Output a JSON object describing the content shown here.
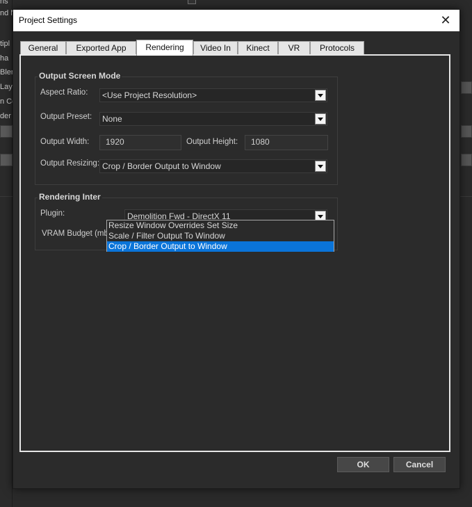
{
  "background": {
    "left_labels": [
      "ns",
      "nd N",
      "tipl",
      "ha",
      "Blen",
      "Lay",
      "n Co",
      "der T"
    ]
  },
  "dialog": {
    "title": "Project Settings",
    "close_symbol": "✕"
  },
  "tabs": [
    {
      "label": "General"
    },
    {
      "label": "Exported App"
    },
    {
      "label": "Rendering",
      "active": true
    },
    {
      "label": "Video In"
    },
    {
      "label": "Kinect"
    },
    {
      "label": "VR"
    },
    {
      "label": "Protocols"
    }
  ],
  "output_screen_mode": {
    "title": "Output Screen Mode",
    "aspect_ratio_label": "Aspect Ratio:",
    "aspect_ratio_value": "<Use Project Resolution>",
    "output_preset_label": "Output Preset:",
    "output_preset_value": "None",
    "output_width_label": "Output Width:",
    "output_width_value": "1920",
    "output_height_label": "Output Height:",
    "output_height_value": "1080",
    "output_resizing_label": "Output Resizing:",
    "output_resizing_value": "Crop / Border Output to Window"
  },
  "resizing_dropdown": {
    "options": [
      "Resize Window Overrides Set Size",
      "Scale / Filter Output To Window",
      "Crop / Border Output to Window"
    ],
    "selected_index": 2
  },
  "rendering_interface": {
    "title": "Rendering Inter",
    "plugin_label": "Plugin:",
    "plugin_value": "Demolition Fwd - DirectX 11",
    "vram_label": "VRAM Budget (mb):",
    "vram_value": ""
  },
  "buttons": {
    "ok": "OK",
    "cancel": "Cancel"
  },
  "colors": {
    "selection": "#0a74d9",
    "dialog_bg": "#2b2b2b",
    "titlebar_bg": "#ffffff"
  }
}
